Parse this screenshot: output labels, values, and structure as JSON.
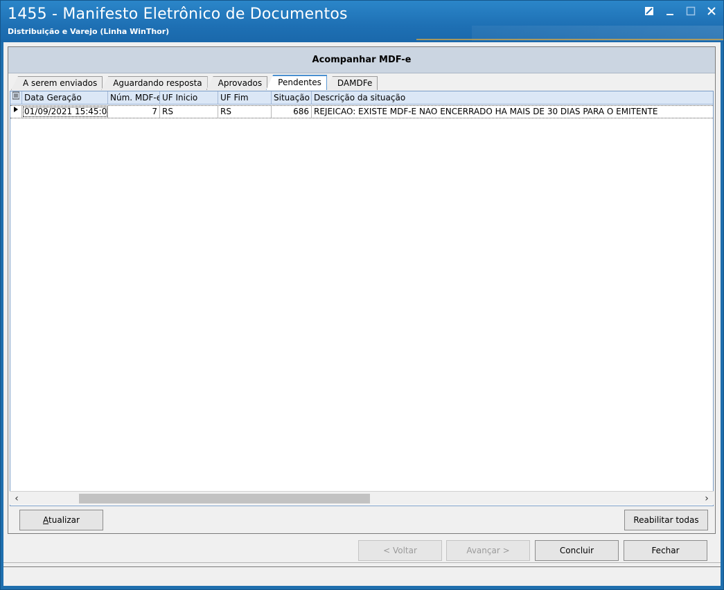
{
  "window": {
    "title": "1455 - Manifesto Eletrônico de Documentos",
    "subtitle": "Distribuição e Varejo (Linha WinThor)",
    "controls": [
      "restore-icon",
      "minimize-icon",
      "maximize-icon",
      "close-icon"
    ]
  },
  "panel": {
    "header": "Acompanhar MDF-e"
  },
  "tabs": [
    {
      "label": "A serem enviados",
      "active": false
    },
    {
      "label": "Aguardando resposta",
      "active": false
    },
    {
      "label": "Aprovados",
      "active": false
    },
    {
      "label": "Pendentes",
      "active": true
    },
    {
      "label": "DAMDFe",
      "active": false
    }
  ],
  "grid": {
    "columns": [
      "Data Geração",
      "Núm. MDF-e",
      "UF Inicio",
      "UF Fim",
      "Situação",
      "Descrição da situação"
    ],
    "rows": [
      {
        "data_geracao": "01/09/2021 15:45:0",
        "num_mdfe": "7",
        "uf_inicio": "RS",
        "uf_fim": "RS",
        "situacao": "686",
        "descricao": "REJEICAO: EXISTE MDF-E NAO ENCERRADO HA MAIS DE 30 DIAS PARA O EMITENTE"
      }
    ]
  },
  "buttons": {
    "atualizar": "Atualizar",
    "reabilitar": "Reabilitar todas",
    "voltar": "< Voltar",
    "avancar": "Avançar >",
    "concluir": "Concluir",
    "fechar": "Fechar"
  }
}
